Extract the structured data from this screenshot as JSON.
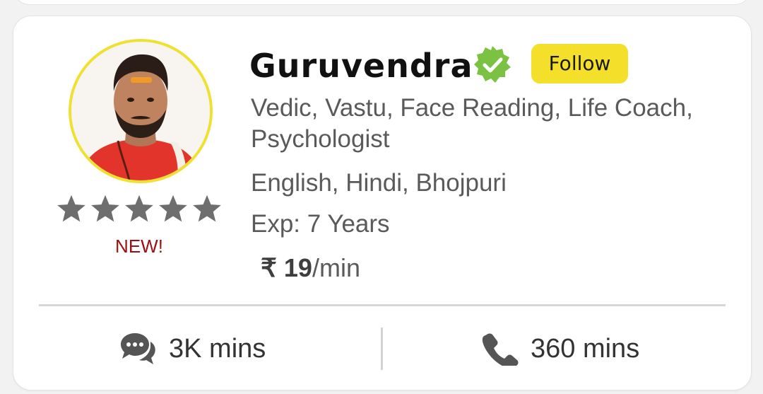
{
  "astrologer": {
    "name": "Guruvendra",
    "follow_label": "Follow",
    "skills": "Vedic, Vastu, Face Reading, Life Coach, Psychologist",
    "languages": "English, Hindi, Bhojpuri",
    "experience": "Exp: 7 Years",
    "price_amount": "₹ 19",
    "price_unit": "/min",
    "new_badge": "NEW!",
    "rating_stars": 5,
    "verified_icon": "verified-badge-icon"
  },
  "stats": {
    "chat_minutes": "3K mins",
    "call_minutes": "360 mins",
    "chat_icon": "chat-bubbles-icon",
    "call_icon": "phone-icon"
  },
  "colors": {
    "follow_button_bg": "#f4e02a",
    "avatar_ring": "#f0e030",
    "verified_green": "#7cc242",
    "new_label": "#9b1111",
    "star_gray": "#6e6e6e"
  }
}
